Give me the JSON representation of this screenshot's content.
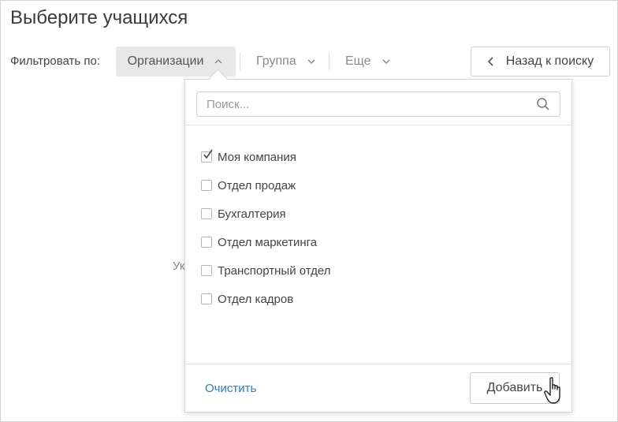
{
  "page": {
    "title": "Выберите учащихся"
  },
  "filters": {
    "label": "Фильтровать по:",
    "items": [
      {
        "label": "Организации",
        "state": "open"
      },
      {
        "label": "Группа"
      },
      {
        "label": "Еще"
      }
    ]
  },
  "back_button": {
    "label": "Назад к поиску"
  },
  "background_text": "Ук",
  "dropdown": {
    "search": {
      "placeholder": "Поиск..."
    },
    "options": [
      {
        "label": "Моя компания",
        "checked": true
      },
      {
        "label": "Отдел продаж",
        "checked": false
      },
      {
        "label": "Бухгалтерия",
        "checked": false
      },
      {
        "label": "Отдел маркетинга",
        "checked": false
      },
      {
        "label": "Транспортный отдел",
        "checked": false
      },
      {
        "label": "Отдел кадров",
        "checked": false
      }
    ],
    "clear_label": "Очистить",
    "add_label": "Добавить"
  },
  "icons": [
    "chevron-up-icon",
    "chevron-down-icon",
    "chevron-left-icon",
    "search-icon",
    "check-icon",
    "hand-pointer-icon"
  ],
  "colors": {
    "link": "#2f7bbf",
    "active_filter_bg": "#e8e8e8"
  }
}
